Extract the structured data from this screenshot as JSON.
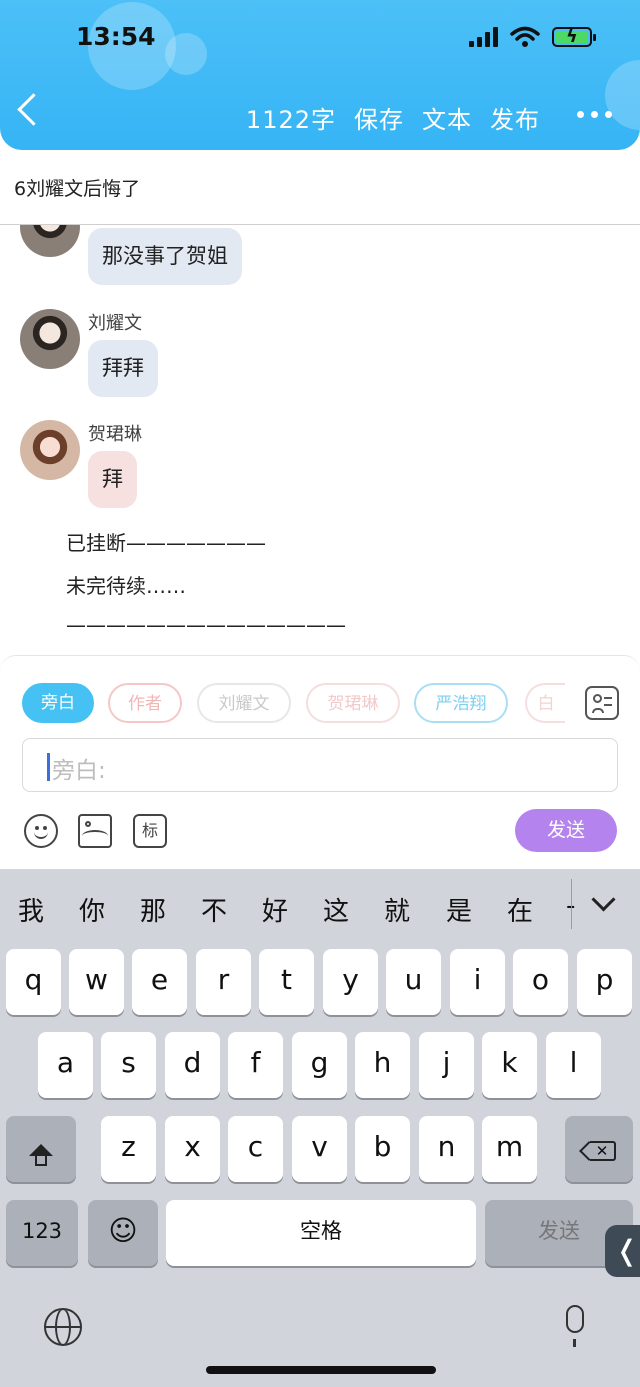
{
  "status": {
    "time": "13:54"
  },
  "header": {
    "word_count": "1122字",
    "actions": [
      "保存",
      "文本",
      "发布"
    ]
  },
  "title": "6刘耀文后悔了",
  "messages": [
    {
      "speaker": "",
      "text": "那没事了贺姐",
      "avatar": "liu-avatar"
    },
    {
      "speaker": "刘耀文",
      "text": "拜拜",
      "avatar": "liu-avatar"
    },
    {
      "speaker": "贺珺琳",
      "text": "拜",
      "avatar": "he-avatar"
    }
  ],
  "narration": [
    "已挂断———————",
    "未完待续……",
    "——————————————"
  ],
  "editor": {
    "chips": [
      "旁白",
      "作者",
      "刘耀文",
      "贺珺琳",
      "严浩翔",
      "白"
    ],
    "placeholder": "旁白:",
    "tag_label": "标",
    "send_label": "发送"
  },
  "keyboard": {
    "candidates": [
      "我",
      "你",
      "那",
      "不",
      "好",
      "这",
      "就",
      "是",
      "在",
      "-"
    ],
    "row1": [
      "q",
      "w",
      "e",
      "r",
      "t",
      "y",
      "u",
      "i",
      "o",
      "p"
    ],
    "row2": [
      "a",
      "s",
      "d",
      "f",
      "g",
      "h",
      "j",
      "k",
      "l"
    ],
    "row3": [
      "z",
      "x",
      "c",
      "v",
      "b",
      "n",
      "m"
    ],
    "numbers_label": "123",
    "space_label": "空格",
    "return_label": "发送",
    "side_tab": "❬"
  },
  "colors": {
    "header": "#39b6f5",
    "active_chip": "#45c2f3",
    "send_button": "#b483ee",
    "bubble_male": "#e3e9f2",
    "bubble_female": "#f6e0e0"
  }
}
